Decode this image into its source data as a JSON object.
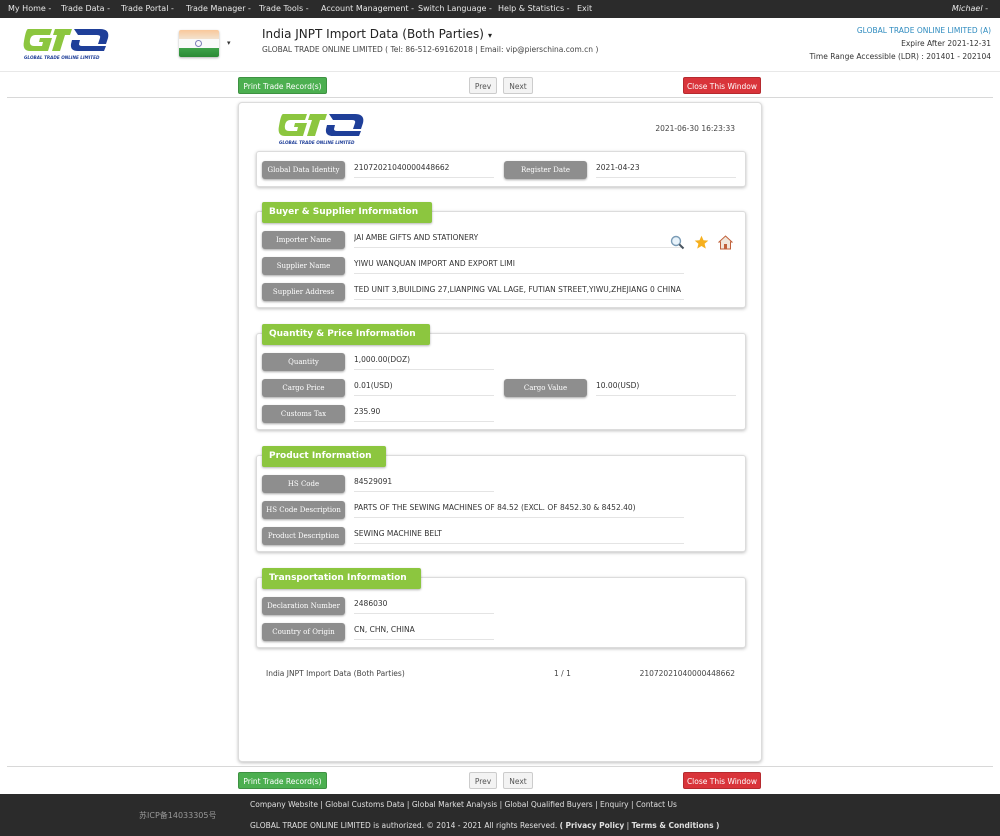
{
  "nav": {
    "items": [
      "My Home -",
      "Trade Data -",
      "Trade Portal -",
      "Trade Manager -",
      "Trade Tools -",
      "Account Management -",
      "Switch Language -",
      "Help & Statistics -",
      "Exit"
    ],
    "user": "Michael -"
  },
  "header": {
    "logo_text": "GLOBAL TRADE ONLINE LIMITED",
    "db_title": "India JNPT Import Data (Both Parties)",
    "db_caret": "▾",
    "flag_caret": "▾",
    "company_line": "GLOBAL TRADE ONLINE LIMITED ( Tel: 86-512-69162018 | Email: vip@pierschina.com.cn )",
    "account_name": "GLOBAL TRADE ONLINE LIMITED (A)",
    "expire": "Expire After 2021-12-31",
    "time_range": "Time Range Accessible (LDR) : 201401 - 202104"
  },
  "buttons": {
    "print": "Print Trade Record(s)",
    "prev": "Prev",
    "next": "Next",
    "close": "Close This Window"
  },
  "record": {
    "timestamp": "2021-06-30 16:23:33",
    "identity": {
      "global_data_identity_label": "Global Data Identity",
      "global_data_identity": "21072021040000448662",
      "register_date_label": "Register Date",
      "register_date": "2021-04-23"
    },
    "buyer_supplier": {
      "title": "Buyer & Supplier Information",
      "importer_name_label": "Importer Name",
      "importer_name": "JAI AMBE GIFTS AND STATIONERY",
      "supplier_name_label": "Supplier Name",
      "supplier_name": "YIWU WANQUAN IMPORT AND EXPORT LIMI",
      "supplier_address_label": "Supplier Address",
      "supplier_address": "TED UNIT 3,BUILDING 27,LIANPING VAL LAGE, FUTIAN STREET,YIWU,ZHEJIANG 0 CHINA",
      "icons": [
        "search-icon",
        "star-icon",
        "home-icon"
      ]
    },
    "quantity_price": {
      "title": "Quantity & Price Information",
      "quantity_label": "Quantity",
      "quantity": "1,000.00(DOZ)",
      "cargo_price_label": "Cargo Price",
      "cargo_price": "0.01(USD)",
      "cargo_value_label": "Cargo Value",
      "cargo_value": "10.00(USD)",
      "customs_tax_label": "Customs Tax",
      "customs_tax": "235.90"
    },
    "product": {
      "title": "Product Information",
      "hs_code_label": "HS Code",
      "hs_code": "84529091",
      "hs_desc_label": "HS Code Description",
      "hs_desc": "PARTS OF THE SEWING MACHINES OF 84.52 (EXCL. OF 8452.30 & 8452.40)",
      "product_desc_label": "Product Description",
      "product_desc": "SEWING MACHINE BELT"
    },
    "transport": {
      "title": "Transportation Information",
      "declaration_number_label": "Declaration Number",
      "declaration_number": "2486030",
      "country_of_origin_label": "Country of Origin",
      "country_of_origin": "CN, CHN, CHINA"
    },
    "footer": {
      "source": "India JNPT Import Data (Both Parties)",
      "page": "1 / 1",
      "id": "21072021040000448662"
    }
  },
  "footer": {
    "icp": "苏ICP备14033305号",
    "links": [
      "Company Website",
      "Global Customs Data",
      "Global Market Analysis",
      "Global Qualified Buyers",
      "Enquiry",
      "Contact Us"
    ],
    "sep": "|",
    "copyright": "GLOBAL TRADE ONLINE LIMITED is authorized. © 2014 - 2021 All rights Reserved.",
    "open_paren": "(",
    "privacy": "Privacy Policy",
    "terms": "Terms & Conditions",
    "close_paren": ")"
  },
  "colors": {
    "nav_bg": "#2b2b2b",
    "accent_green": "#8cc63f",
    "print_green": "#4caf50",
    "close_red": "#d9343a",
    "label_gray": "#8e8e8e",
    "account_blue": "#2e8bbf",
    "logo_green": "#8cc63f",
    "logo_blue": "#1f3f99"
  }
}
